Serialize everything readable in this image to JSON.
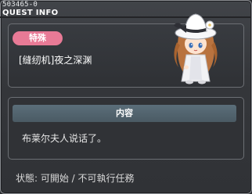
{
  "header": {
    "quest_id": "503465-0",
    "title": "QUEST INFO"
  },
  "quest": {
    "category_badge": "特殊",
    "name": "[缝纫机]夜之深渊",
    "npc_icon": "npc-lady-white-hat-icon"
  },
  "content": {
    "header": "内容",
    "text": "布莱尔夫人说话了。"
  },
  "footer": {
    "status": "状態:  可開始 / 不可執行任務"
  },
  "colors": {
    "badge": "#e87a96",
    "content_header": "#4f606b",
    "panel_border": "#6c6f74"
  }
}
